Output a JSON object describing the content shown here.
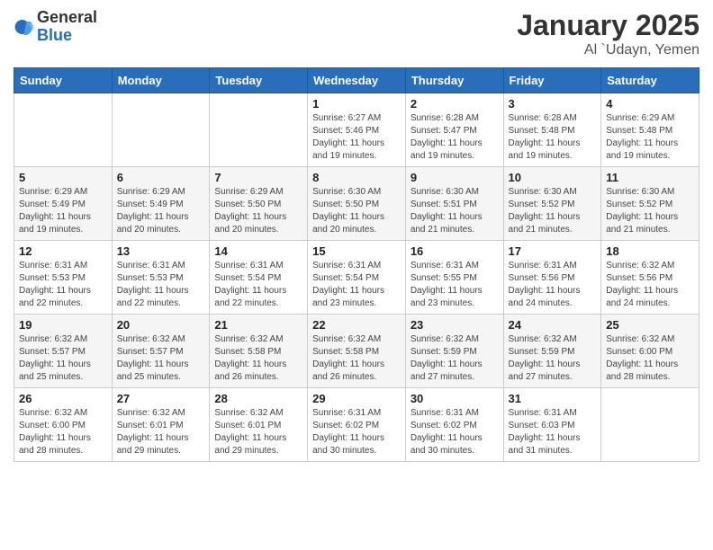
{
  "logo": {
    "general": "General",
    "blue": "Blue"
  },
  "title": "January 2025",
  "subtitle": "Al `Udayn, Yemen",
  "days_of_week": [
    "Sunday",
    "Monday",
    "Tuesday",
    "Wednesday",
    "Thursday",
    "Friday",
    "Saturday"
  ],
  "weeks": [
    [
      {
        "day": "",
        "info": ""
      },
      {
        "day": "",
        "info": ""
      },
      {
        "day": "",
        "info": ""
      },
      {
        "day": "1",
        "info": "Sunrise: 6:27 AM\nSunset: 5:46 PM\nDaylight: 11 hours and 19 minutes."
      },
      {
        "day": "2",
        "info": "Sunrise: 6:28 AM\nSunset: 5:47 PM\nDaylight: 11 hours and 19 minutes."
      },
      {
        "day": "3",
        "info": "Sunrise: 6:28 AM\nSunset: 5:48 PM\nDaylight: 11 hours and 19 minutes."
      },
      {
        "day": "4",
        "info": "Sunrise: 6:29 AM\nSunset: 5:48 PM\nDaylight: 11 hours and 19 minutes."
      }
    ],
    [
      {
        "day": "5",
        "info": "Sunrise: 6:29 AM\nSunset: 5:49 PM\nDaylight: 11 hours and 19 minutes."
      },
      {
        "day": "6",
        "info": "Sunrise: 6:29 AM\nSunset: 5:49 PM\nDaylight: 11 hours and 20 minutes."
      },
      {
        "day": "7",
        "info": "Sunrise: 6:29 AM\nSunset: 5:50 PM\nDaylight: 11 hours and 20 minutes."
      },
      {
        "day": "8",
        "info": "Sunrise: 6:30 AM\nSunset: 5:50 PM\nDaylight: 11 hours and 20 minutes."
      },
      {
        "day": "9",
        "info": "Sunrise: 6:30 AM\nSunset: 5:51 PM\nDaylight: 11 hours and 21 minutes."
      },
      {
        "day": "10",
        "info": "Sunrise: 6:30 AM\nSunset: 5:52 PM\nDaylight: 11 hours and 21 minutes."
      },
      {
        "day": "11",
        "info": "Sunrise: 6:30 AM\nSunset: 5:52 PM\nDaylight: 11 hours and 21 minutes."
      }
    ],
    [
      {
        "day": "12",
        "info": "Sunrise: 6:31 AM\nSunset: 5:53 PM\nDaylight: 11 hours and 22 minutes."
      },
      {
        "day": "13",
        "info": "Sunrise: 6:31 AM\nSunset: 5:53 PM\nDaylight: 11 hours and 22 minutes."
      },
      {
        "day": "14",
        "info": "Sunrise: 6:31 AM\nSunset: 5:54 PM\nDaylight: 11 hours and 22 minutes."
      },
      {
        "day": "15",
        "info": "Sunrise: 6:31 AM\nSunset: 5:54 PM\nDaylight: 11 hours and 23 minutes."
      },
      {
        "day": "16",
        "info": "Sunrise: 6:31 AM\nSunset: 5:55 PM\nDaylight: 11 hours and 23 minutes."
      },
      {
        "day": "17",
        "info": "Sunrise: 6:31 AM\nSunset: 5:56 PM\nDaylight: 11 hours and 24 minutes."
      },
      {
        "day": "18",
        "info": "Sunrise: 6:32 AM\nSunset: 5:56 PM\nDaylight: 11 hours and 24 minutes."
      }
    ],
    [
      {
        "day": "19",
        "info": "Sunrise: 6:32 AM\nSunset: 5:57 PM\nDaylight: 11 hours and 25 minutes."
      },
      {
        "day": "20",
        "info": "Sunrise: 6:32 AM\nSunset: 5:57 PM\nDaylight: 11 hours and 25 minutes."
      },
      {
        "day": "21",
        "info": "Sunrise: 6:32 AM\nSunset: 5:58 PM\nDaylight: 11 hours and 26 minutes."
      },
      {
        "day": "22",
        "info": "Sunrise: 6:32 AM\nSunset: 5:58 PM\nDaylight: 11 hours and 26 minutes."
      },
      {
        "day": "23",
        "info": "Sunrise: 6:32 AM\nSunset: 5:59 PM\nDaylight: 11 hours and 27 minutes."
      },
      {
        "day": "24",
        "info": "Sunrise: 6:32 AM\nSunset: 5:59 PM\nDaylight: 11 hours and 27 minutes."
      },
      {
        "day": "25",
        "info": "Sunrise: 6:32 AM\nSunset: 6:00 PM\nDaylight: 11 hours and 28 minutes."
      }
    ],
    [
      {
        "day": "26",
        "info": "Sunrise: 6:32 AM\nSunset: 6:00 PM\nDaylight: 11 hours and 28 minutes."
      },
      {
        "day": "27",
        "info": "Sunrise: 6:32 AM\nSunset: 6:01 PM\nDaylight: 11 hours and 29 minutes."
      },
      {
        "day": "28",
        "info": "Sunrise: 6:32 AM\nSunset: 6:01 PM\nDaylight: 11 hours and 29 minutes."
      },
      {
        "day": "29",
        "info": "Sunrise: 6:31 AM\nSunset: 6:02 PM\nDaylight: 11 hours and 30 minutes."
      },
      {
        "day": "30",
        "info": "Sunrise: 6:31 AM\nSunset: 6:02 PM\nDaylight: 11 hours and 30 minutes."
      },
      {
        "day": "31",
        "info": "Sunrise: 6:31 AM\nSunset: 6:03 PM\nDaylight: 11 hours and 31 minutes."
      },
      {
        "day": "",
        "info": ""
      }
    ]
  ]
}
